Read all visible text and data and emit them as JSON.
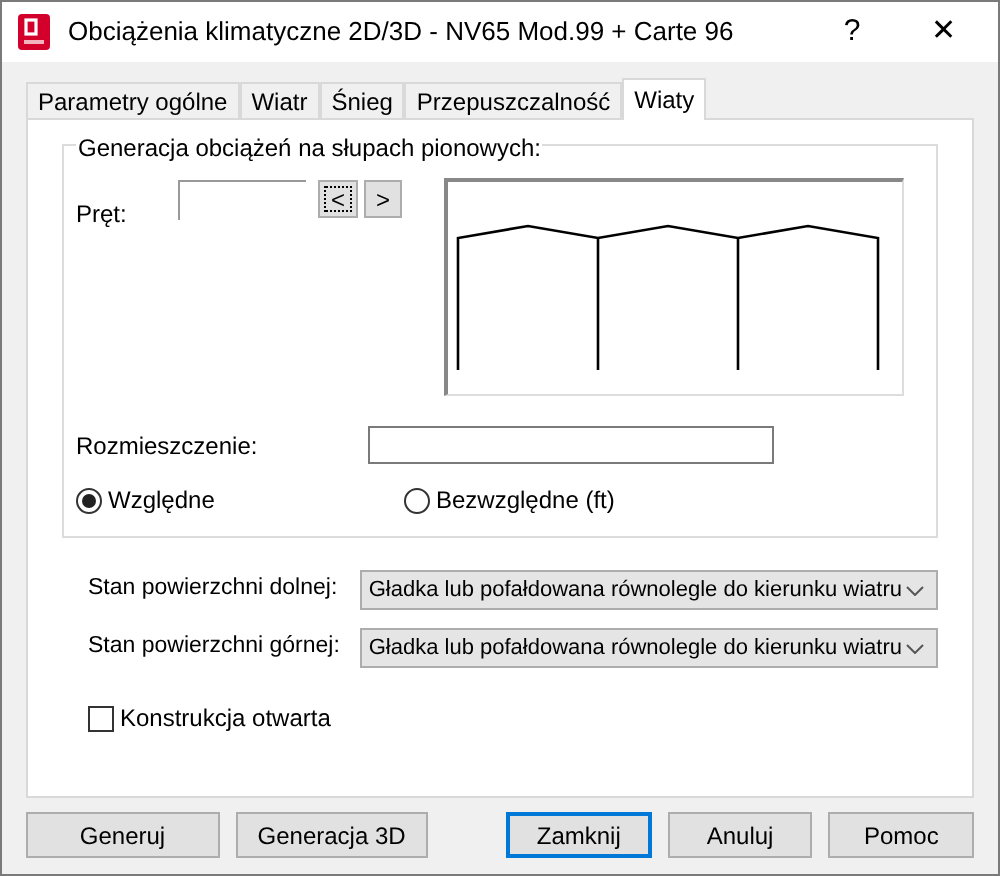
{
  "window": {
    "title": "Obciążenia klimatyczne 2D/3D - NV65 Mod.99 + Carte 96",
    "help_button": "?",
    "close_button": "✕"
  },
  "tabs": [
    {
      "label": "Parametry ogólne",
      "selected": false
    },
    {
      "label": "Wiatr",
      "selected": false
    },
    {
      "label": "Śnieg",
      "selected": false
    },
    {
      "label": "Przepuszczalność",
      "selected": false
    },
    {
      "label": "Wiaty",
      "selected": true
    }
  ],
  "group": {
    "title": "Generacja obciążeń na słupach pionowych:",
    "bar_label": "Pręt:",
    "prev_button": "<",
    "next_button": ">",
    "placement_label": "Rozmieszczenie:",
    "radios": [
      {
        "label": "Względne",
        "selected": true
      },
      {
        "label": "Bezwzględne (ft)",
        "selected": false
      }
    ]
  },
  "surfaces": [
    {
      "label": "Stan powierzchni dolnej:",
      "value": "Gładka lub pofałdowana równolegle do kierunku wiatru"
    },
    {
      "label": "Stan powierzchni górnej:",
      "value": "Gładka lub pofałdowana równolegle do kierunku wiatru"
    }
  ],
  "open_structure": {
    "label": "Konstrukcja otwarta",
    "checked": false
  },
  "buttons": [
    {
      "label": "Generuj",
      "default": false
    },
    {
      "label": "Generacja 3D",
      "default": false
    },
    {
      "label": "Zamknij",
      "default": true
    },
    {
      "label": "Anuluj",
      "default": false
    },
    {
      "label": "Pomoc",
      "default": false
    }
  ]
}
